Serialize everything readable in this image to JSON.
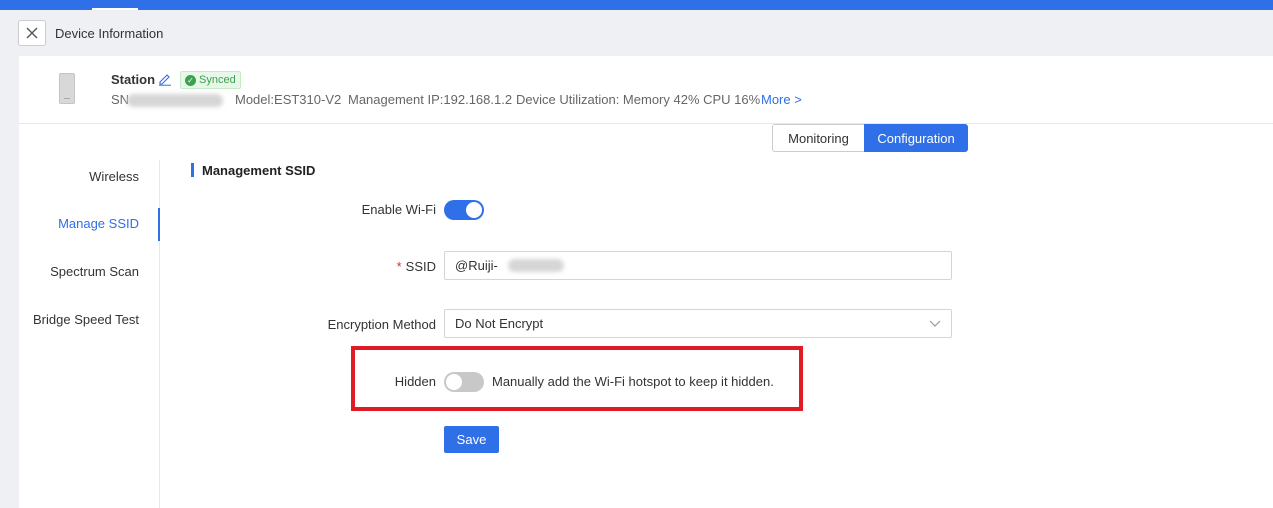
{
  "drawer": {
    "title": "Device Information"
  },
  "device": {
    "name": "Station",
    "sync_status": "Synced",
    "sn_label": "SN",
    "model": "Model:EST310-V2",
    "management_ip": "Management IP:192.168.1.2",
    "utilization": "Device Utilization: Memory 42% CPU 16%",
    "more_link": "More >"
  },
  "view_tabs": {
    "monitoring": "Monitoring",
    "configuration": "Configuration",
    "selected": "Configuration"
  },
  "sidebar": {
    "items": [
      {
        "label": "Wireless",
        "active": false
      },
      {
        "label": "Manage SSID",
        "active": true
      },
      {
        "label": "Spectrum Scan",
        "active": false
      },
      {
        "label": "Bridge Speed Test",
        "active": false
      }
    ]
  },
  "form": {
    "section_title": "Management SSID",
    "enable_wifi": {
      "label": "Enable Wi-Fi",
      "value": true
    },
    "ssid": {
      "label": "SSID",
      "required": true,
      "value": "@Ruiji-"
    },
    "encryption": {
      "label": "Encryption Method",
      "value": "Do Not Encrypt"
    },
    "hidden": {
      "label": "Hidden",
      "value": false,
      "hint": "Manually add the Wi-Fi hotspot to keep it hidden."
    },
    "save_label": "Save"
  },
  "colors": {
    "accent": "#2f6fe8",
    "highlight_border": "#e01b24",
    "synced_green": "#3aa34b"
  }
}
